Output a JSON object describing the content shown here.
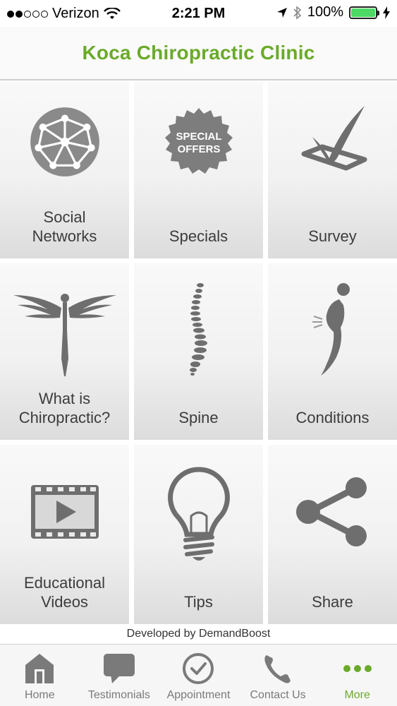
{
  "status_bar": {
    "carrier": "Verizon",
    "time": "2:21 PM",
    "battery": "100%",
    "signal_bars_total": 5,
    "signal_bars_filled": 2
  },
  "header": {
    "title": "Koca Chiropractic Clinic",
    "title_color": "#6aaa2a"
  },
  "tiles": [
    {
      "label": "Social\nNetworks",
      "icon": "globe-network-icon"
    },
    {
      "label": "Specials",
      "icon": "special-offers-badge-icon",
      "badge_line1": "SPECIAL",
      "badge_line2": "OFFERS"
    },
    {
      "label": "Survey",
      "icon": "checkbox-check-icon"
    },
    {
      "label": "What is\nChiropractic?",
      "icon": "winged-figure-icon"
    },
    {
      "label": "Spine",
      "icon": "spine-icon"
    },
    {
      "label": "Conditions",
      "icon": "back-pain-figure-icon"
    },
    {
      "label": "Educational\nVideos",
      "icon": "film-play-icon"
    },
    {
      "label": "Tips",
      "icon": "lightbulb-icon"
    },
    {
      "label": "Share",
      "icon": "share-icon"
    }
  ],
  "footer": {
    "developer_text": "Developed by DemandBoost"
  },
  "tab_bar": {
    "active_index": 4,
    "accent_color": "#6aaa2a",
    "tabs": [
      {
        "label": "Home",
        "icon": "home-icon"
      },
      {
        "label": "Testimonials",
        "icon": "speech-bubble-icon"
      },
      {
        "label": "Appointment",
        "icon": "clock-check-icon"
      },
      {
        "label": "Contact Us",
        "icon": "phone-icon"
      },
      {
        "label": "More",
        "icon": "more-dots-icon"
      }
    ]
  }
}
